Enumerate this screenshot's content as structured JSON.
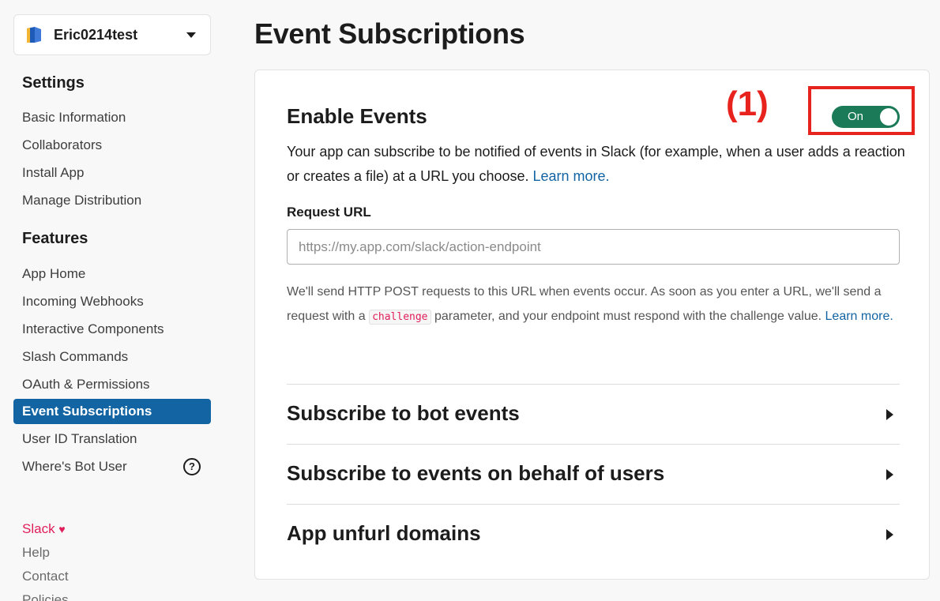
{
  "workspace": {
    "name": "Eric0214test",
    "icon": "book-icon"
  },
  "sidebar": {
    "settings_heading": "Settings",
    "settings_items": [
      {
        "label": "Basic Information"
      },
      {
        "label": "Collaborators"
      },
      {
        "label": "Install App"
      },
      {
        "label": "Manage Distribution"
      }
    ],
    "features_heading": "Features",
    "features_items": [
      {
        "label": "App Home"
      },
      {
        "label": "Incoming Webhooks"
      },
      {
        "label": "Interactive Components"
      },
      {
        "label": "Slash Commands"
      },
      {
        "label": "OAuth & Permissions"
      },
      {
        "label": "Event Subscriptions",
        "active": true
      },
      {
        "label": "User ID Translation"
      },
      {
        "label": "Where's Bot User"
      }
    ],
    "help_icon": "?",
    "footer": {
      "slack": "Slack",
      "heart": "♥",
      "help": "Help",
      "contact": "Contact",
      "policies": "Policies"
    }
  },
  "main": {
    "title": "Event Subscriptions",
    "enable": {
      "title": "Enable Events",
      "annotation": "(1)",
      "toggle_label": "On",
      "toggle_state": "on",
      "description": "Your app can subscribe to be notified of events in Slack (for example, when a user adds a reaction or creates a file) at a URL you choose.",
      "learn_more": "Learn more."
    },
    "request_url": {
      "label": "Request URL",
      "value": "",
      "placeholder": "https://my.app.com/slack/action-endpoint",
      "help_part1": "We'll send HTTP POST requests to this URL when events occur. As soon as you enter a URL, we'll send a request with a",
      "code": "challenge",
      "help_part2": "parameter, and your endpoint must respond with the challenge value.",
      "learn_more": "Learn more."
    },
    "sections": [
      {
        "title": "Subscribe to bot events"
      },
      {
        "title": "Subscribe to events on behalf of users"
      },
      {
        "title": "App unfurl domains"
      }
    ]
  },
  "colors": {
    "accent": "#1264a3",
    "toggle_on": "#1b7a57",
    "annotation": "#e8231d",
    "slack_pink": "#e01e5a"
  }
}
